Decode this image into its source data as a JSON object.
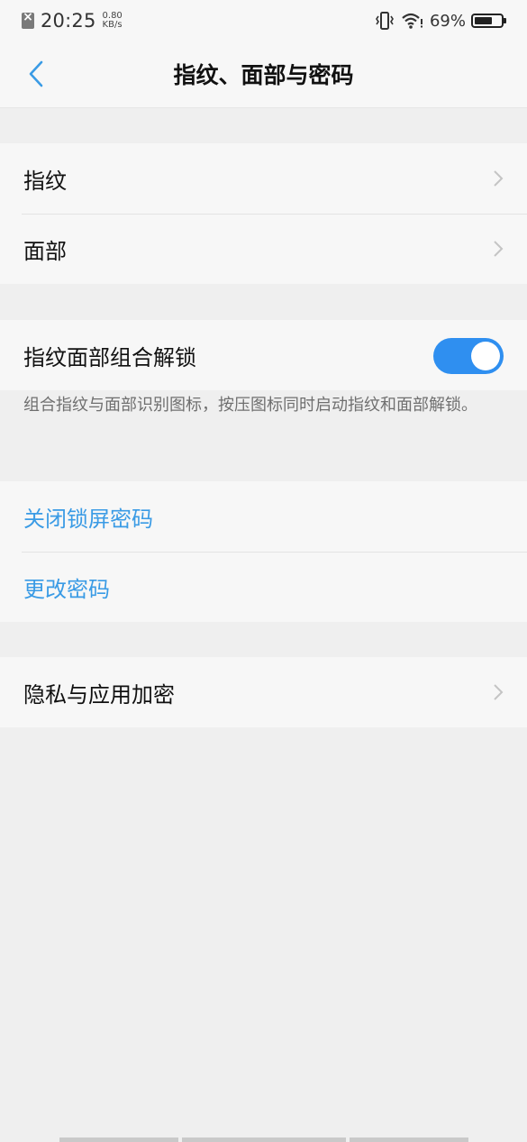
{
  "status_bar": {
    "time": "20:25",
    "speed_value": "0.80",
    "speed_unit": "KB/s",
    "battery": "69%",
    "battery_level": 0.69
  },
  "header": {
    "title": "指纹、面部与密码",
    "back_icon": "chevron-left-icon"
  },
  "biometrics": {
    "items": [
      {
        "label": "指纹"
      },
      {
        "label": "面部"
      }
    ]
  },
  "combo": {
    "label": "指纹面部组合解锁",
    "enabled": true,
    "description": "组合指纹与面部识别图标，按压图标同时启动指纹和面部解锁。"
  },
  "password": {
    "close_label": "关闭锁屏密码",
    "change_label": "更改密码"
  },
  "privacy": {
    "label": "隐私与应用加密"
  },
  "colors": {
    "accent": "#2f8ff0",
    "link": "#3a9be5",
    "background": "#efefef",
    "surface": "#f7f7f7"
  }
}
